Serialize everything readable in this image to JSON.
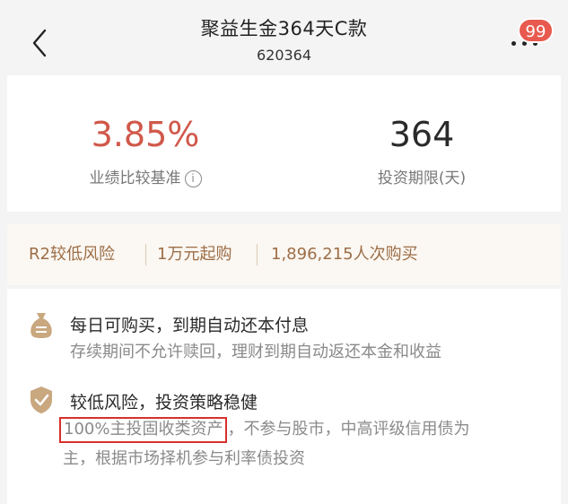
{
  "header": {
    "title": "聚益生金364天C款",
    "code": "620364",
    "badge_count": "99"
  },
  "stats": {
    "rate_value": "3.85%",
    "rate_label": "业绩比较基准",
    "term_value": "364",
    "term_label": "投资期限(天)"
  },
  "tags": [
    "R2较低风险",
    "1万元起购",
    "1,896,215人次购买"
  ],
  "features": [
    {
      "icon": "money-bag-icon",
      "title": "每日可购买，到期自动还本付息",
      "desc": "存续期间不允许赎回，理财到期自动返还本金和收益"
    },
    {
      "icon": "shield-check-icon",
      "title": "较低风险，投资策略稳健",
      "desc_highlight": "100%主投固收类资产",
      "desc_rest_line1": "，不参与股市，中高评级信用债为",
      "desc_rest_line2": "主，根据市场择机参与利率债投资"
    }
  ],
  "colors": {
    "rate_red": "#d0584a",
    "tag_brown": "#9c6e47",
    "badge_red": "#e85a4f",
    "highlight_red": "#d8302c",
    "icon_tan": "#c9a77f"
  }
}
